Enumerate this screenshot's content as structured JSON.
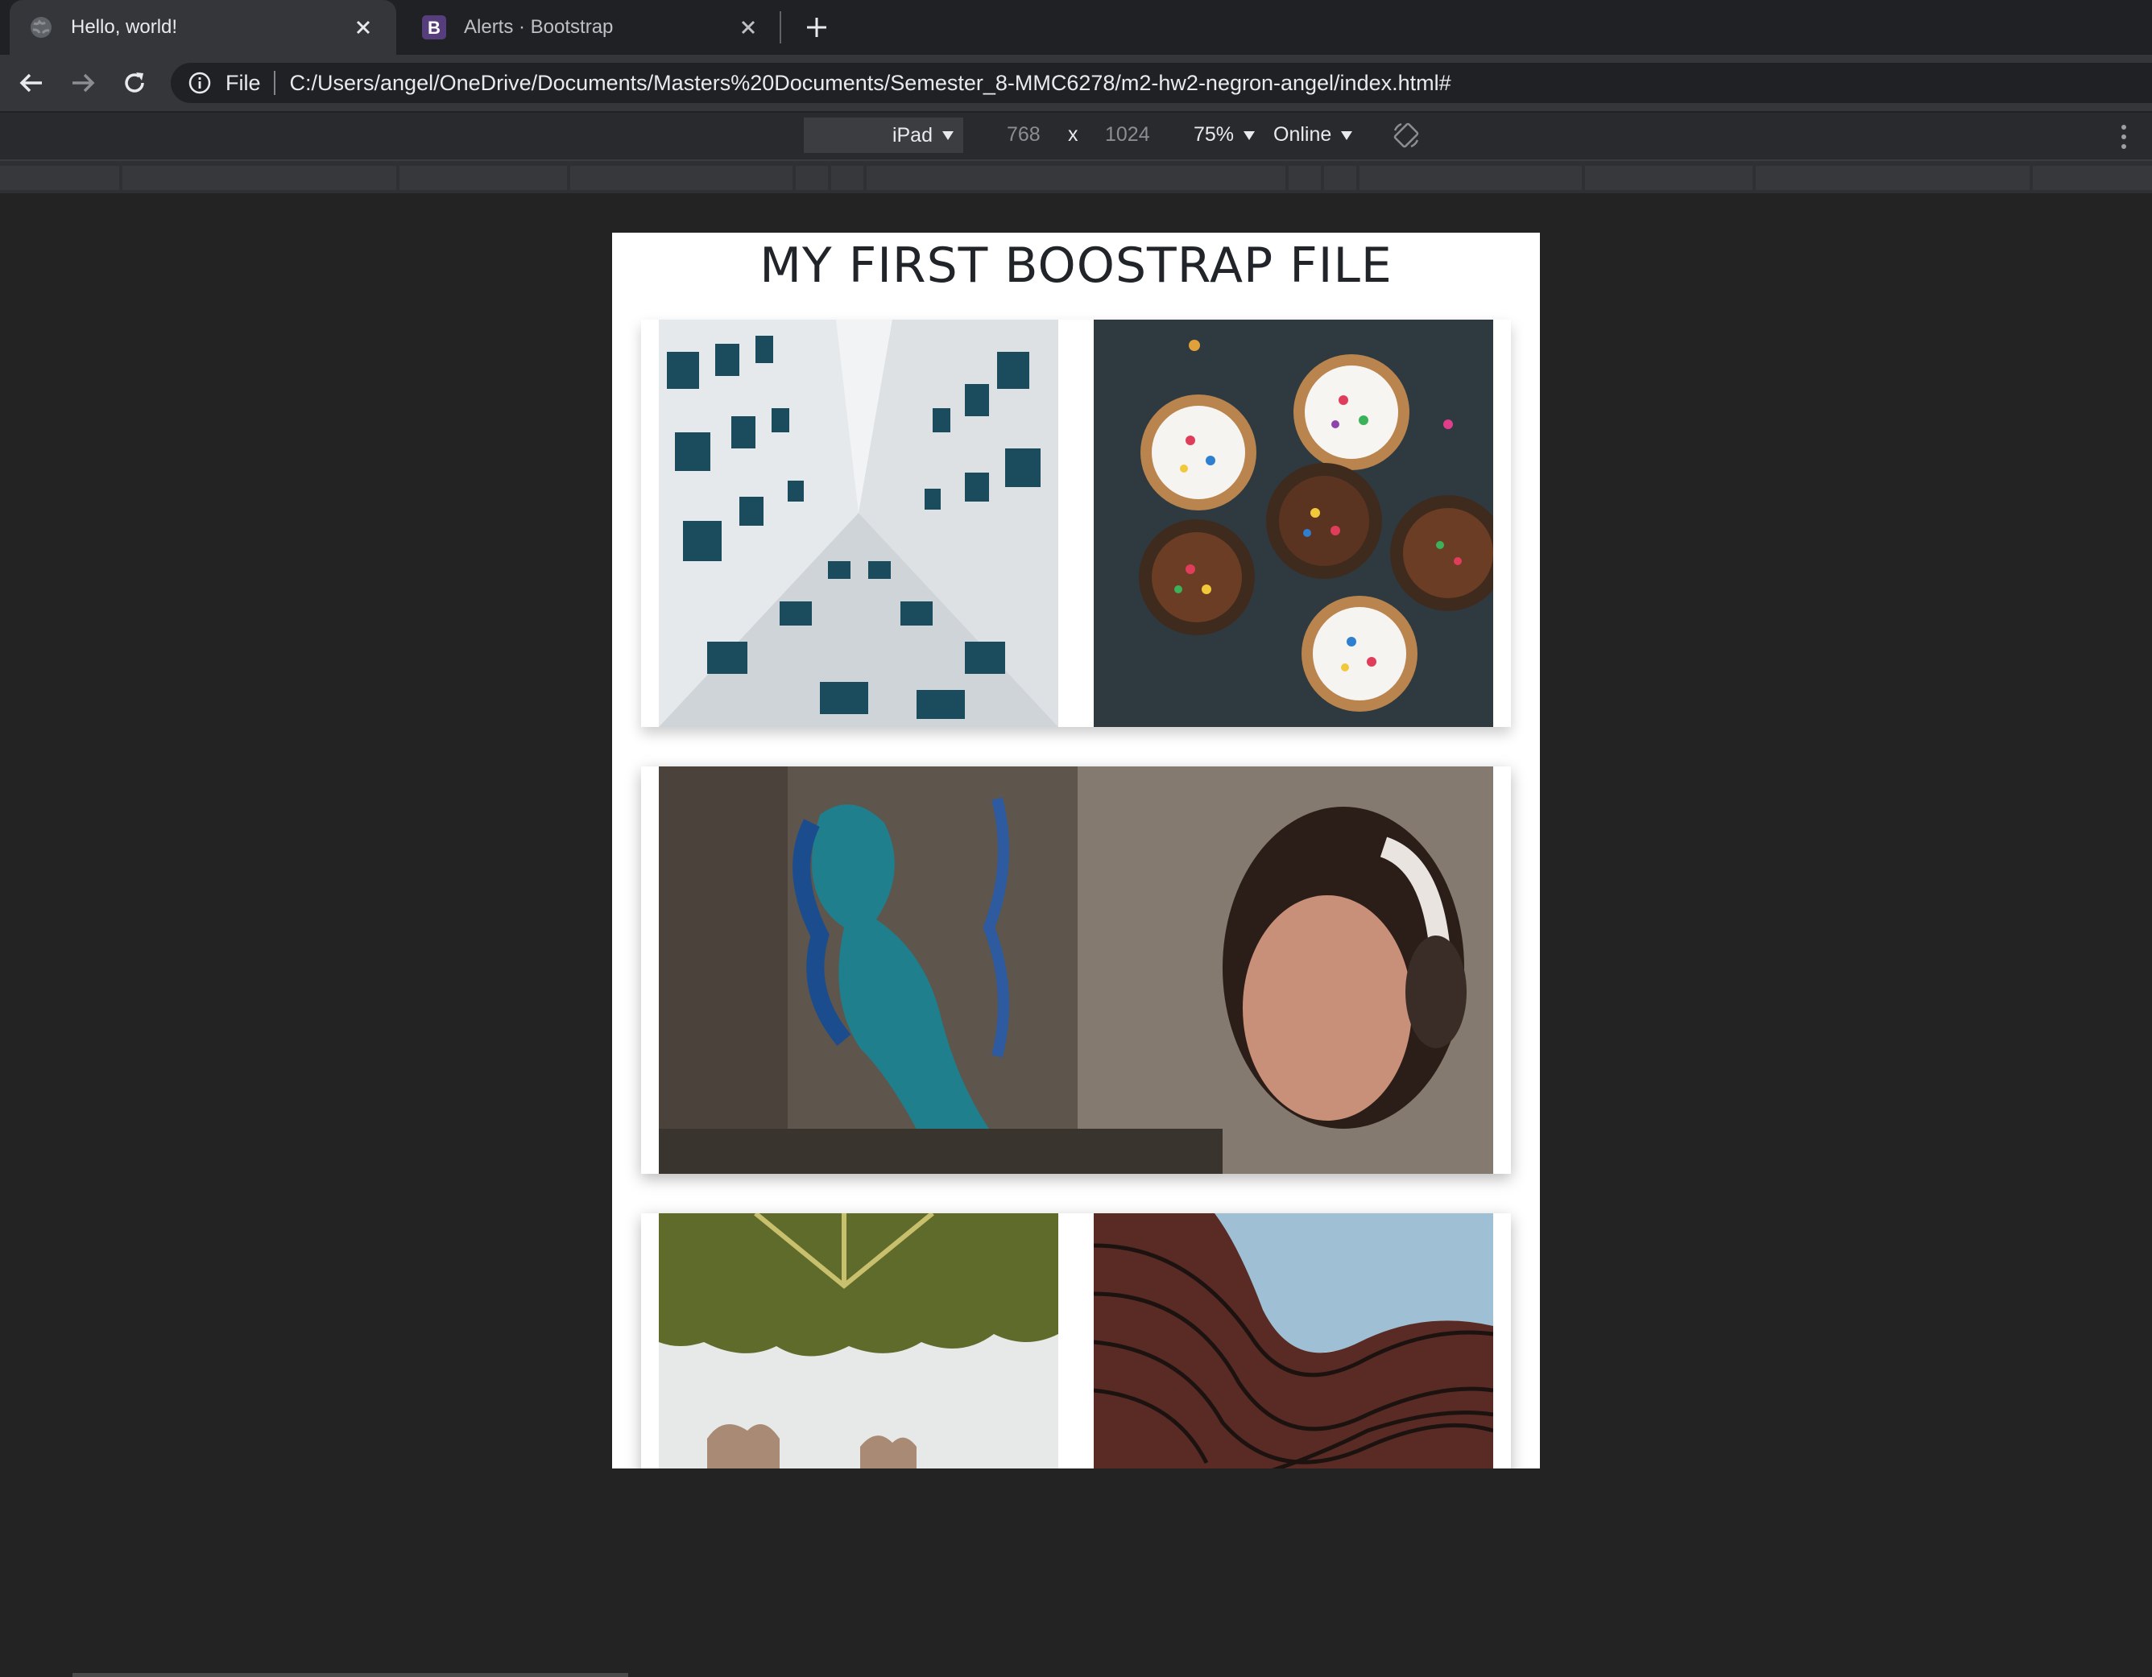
{
  "browser": {
    "tabs": [
      {
        "title": "Hello, world!",
        "active": true,
        "icon": "globe-icon"
      },
      {
        "title": "Alerts · Bootstrap",
        "active": false,
        "icon": "bootstrap-icon",
        "icon_letter": "B"
      }
    ],
    "address": {
      "scheme_label": "File",
      "url": "C:/Users/angel/OneDrive/Documents/Masters%20Documents/Semester_8-MMC6278/m2-hw2-negron-angel/index.html#"
    }
  },
  "device_toolbar": {
    "device": "iPad",
    "width": "768",
    "times": "x",
    "height": "1024",
    "zoom": "75%",
    "network": "Online"
  },
  "page": {
    "title": "MY FIRST BOOSTRAP FILE",
    "images": [
      {
        "subject": "building-windows-upward"
      },
      {
        "subject": "cupcakes-sprinkles"
      },
      {
        "subject": "street-art-woman-headphones"
      },
      {
        "subject": "upside-down-trees"
      },
      {
        "subject": "wavy-building"
      }
    ]
  },
  "colors": {
    "chrome_dark": "#202124",
    "chrome_tab": "#35363a",
    "page_background": "#232323",
    "viewport": "#ffffff",
    "bootstrap_purple": "#563d7c"
  }
}
